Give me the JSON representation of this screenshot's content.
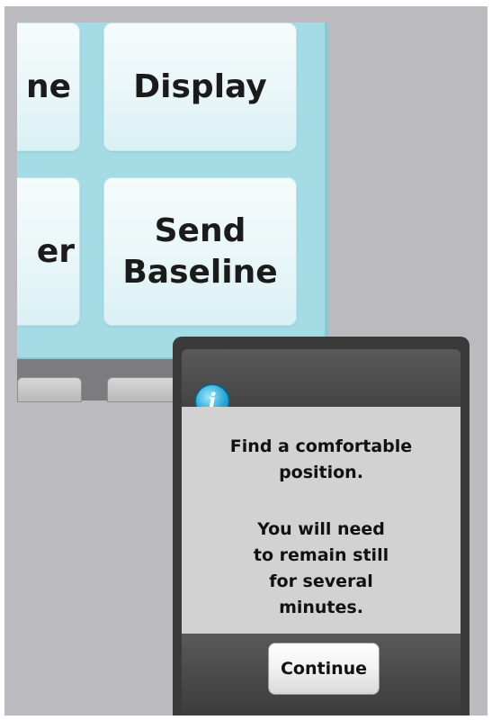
{
  "tiles": {
    "name": "ne",
    "display": "Display",
    "left_partial": "er",
    "send_baseline": "Send\nBaseline"
  },
  "dialog": {
    "icon": "info-icon",
    "icon_glyph": "i",
    "message_1": "Find a comfortable\nposition.",
    "message_2": "You will need\nto remain still\nfor several\nminutes.",
    "continue_label": "Continue"
  },
  "colors": {
    "screen_bg": "#a4dbe4",
    "tile_bg": "#eef8fa",
    "frame_bg": "#bbbbbf",
    "dialog_dark": "#3a3a3a",
    "dialog_body": "#d2d2d2",
    "info_icon": "#2aa7d6"
  }
}
